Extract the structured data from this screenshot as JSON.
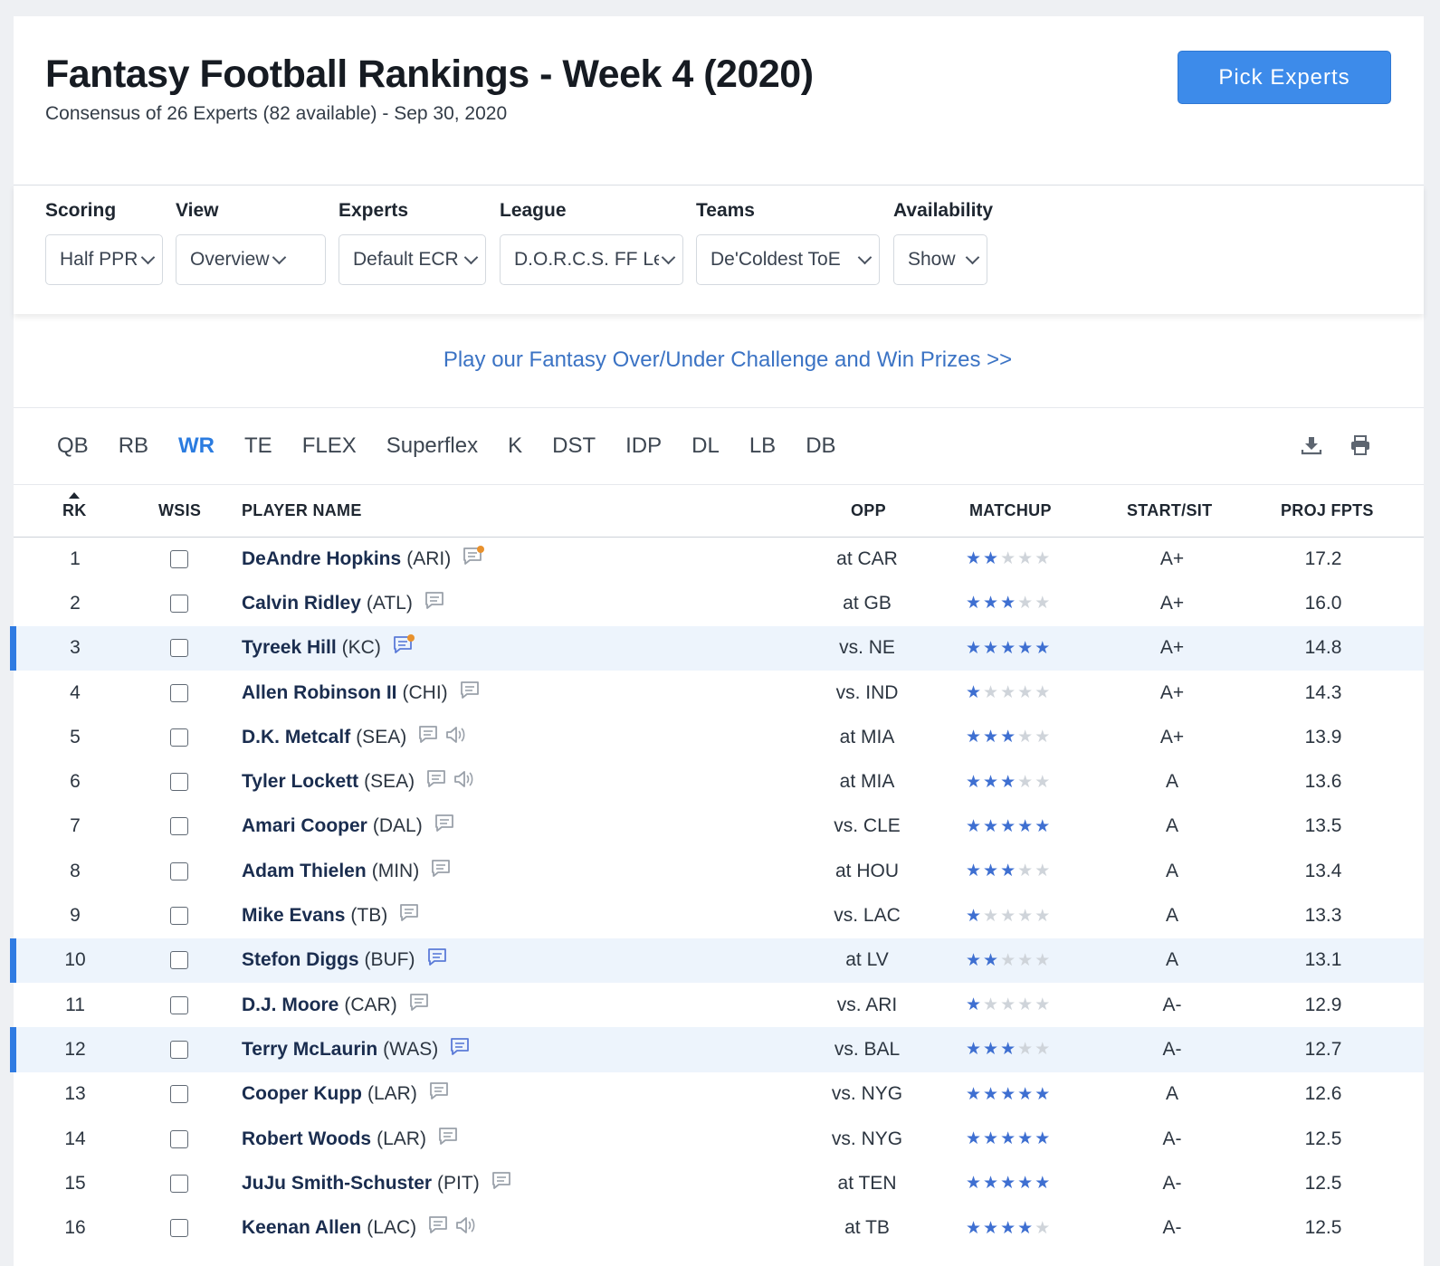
{
  "header": {
    "title": "Fantasy Football Rankings - Week 4 (2020)",
    "subtitle": "Consensus of 26 Experts (82 available) - Sep 30, 2020",
    "pick_experts_label": "Pick Experts"
  },
  "filters": {
    "scoring": {
      "label": "Scoring",
      "value": "Half PPR"
    },
    "view": {
      "label": "View",
      "value": "Overview"
    },
    "experts": {
      "label": "Experts",
      "value": "Default ECR"
    },
    "league": {
      "label": "League",
      "value": "D.O.R.C.S. FF League"
    },
    "teams": {
      "label": "Teams",
      "value": "De'Coldest ToE"
    },
    "availability": {
      "label": "Availability",
      "value": "Show"
    }
  },
  "promo": {
    "text": "Play our Fantasy Over/Under Challenge and Win Prizes >>"
  },
  "position_tabs": [
    "QB",
    "RB",
    "WR",
    "TE",
    "FLEX",
    "Superflex",
    "K",
    "DST",
    "IDP",
    "DL",
    "LB",
    "DB"
  ],
  "active_tab": "WR",
  "table": {
    "columns": {
      "rk": "RK",
      "wsis": "WSIS",
      "player": "PLAYER NAME",
      "opp": "OPP",
      "matchup": "MATCHUP",
      "start_sit": "START/SIT",
      "proj": "PROJ FPTS"
    },
    "rows": [
      {
        "rk": "1",
        "name": "DeAndre Hopkins",
        "team": "(ARI)",
        "opp": "at CAR",
        "stars": 2,
        "grade": "A+",
        "proj": "17.2",
        "note": "new",
        "audio": false,
        "highlight": false
      },
      {
        "rk": "2",
        "name": "Calvin Ridley",
        "team": "(ATL)",
        "opp": "at GB",
        "stars": 3,
        "grade": "A+",
        "proj": "16.0",
        "note": "gray",
        "audio": false,
        "highlight": false
      },
      {
        "rk": "3",
        "name": "Tyreek Hill",
        "team": "(KC)",
        "opp": "vs. NE",
        "stars": 5,
        "grade": "A+",
        "proj": "14.8",
        "note": "new-blue",
        "audio": false,
        "highlight": true
      },
      {
        "rk": "4",
        "name": "Allen Robinson II",
        "team": "(CHI)",
        "opp": "vs. IND",
        "stars": 1,
        "grade": "A+",
        "proj": "14.3",
        "note": "gray",
        "audio": false,
        "highlight": false
      },
      {
        "rk": "5",
        "name": "D.K. Metcalf",
        "team": "(SEA)",
        "opp": "at MIA",
        "stars": 3,
        "grade": "A+",
        "proj": "13.9",
        "note": "gray",
        "audio": true,
        "highlight": false
      },
      {
        "rk": "6",
        "name": "Tyler Lockett",
        "team": "(SEA)",
        "opp": "at MIA",
        "stars": 3,
        "grade": "A",
        "proj": "13.6",
        "note": "gray",
        "audio": true,
        "highlight": false
      },
      {
        "rk": "7",
        "name": "Amari Cooper",
        "team": "(DAL)",
        "opp": "vs. CLE",
        "stars": 5,
        "grade": "A",
        "proj": "13.5",
        "note": "gray",
        "audio": false,
        "highlight": false
      },
      {
        "rk": "8",
        "name": "Adam Thielen",
        "team": "(MIN)",
        "opp": "at HOU",
        "stars": 3,
        "grade": "A",
        "proj": "13.4",
        "note": "gray",
        "audio": false,
        "highlight": false
      },
      {
        "rk": "9",
        "name": "Mike Evans",
        "team": "(TB)",
        "opp": "vs. LAC",
        "stars": 1,
        "grade": "A",
        "proj": "13.3",
        "note": "gray",
        "audio": false,
        "highlight": false
      },
      {
        "rk": "10",
        "name": "Stefon Diggs",
        "team": "(BUF)",
        "opp": "at LV",
        "stars": 2,
        "grade": "A",
        "proj": "13.1",
        "note": "blue",
        "audio": false,
        "highlight": true
      },
      {
        "rk": "11",
        "name": "D.J. Moore",
        "team": "(CAR)",
        "opp": "vs. ARI",
        "stars": 1,
        "grade": "A-",
        "proj": "12.9",
        "note": "gray",
        "audio": false,
        "highlight": false
      },
      {
        "rk": "12",
        "name": "Terry McLaurin",
        "team": "(WAS)",
        "opp": "vs. BAL",
        "stars": 3,
        "grade": "A-",
        "proj": "12.7",
        "note": "blue",
        "audio": false,
        "highlight": true
      },
      {
        "rk": "13",
        "name": "Cooper Kupp",
        "team": "(LAR)",
        "opp": "vs. NYG",
        "stars": 5,
        "grade": "A",
        "proj": "12.6",
        "note": "gray",
        "audio": false,
        "highlight": false
      },
      {
        "rk": "14",
        "name": "Robert Woods",
        "team": "(LAR)",
        "opp": "vs. NYG",
        "stars": 5,
        "grade": "A-",
        "proj": "12.5",
        "note": "gray",
        "audio": false,
        "highlight": false
      },
      {
        "rk": "15",
        "name": "JuJu Smith-Schuster",
        "team": "(PIT)",
        "opp": "at TEN",
        "stars": 5,
        "grade": "A-",
        "proj": "12.5",
        "note": "gray",
        "audio": false,
        "highlight": false
      },
      {
        "rk": "16",
        "name": "Keenan Allen",
        "team": "(LAC)",
        "opp": "at TB",
        "stars": 4,
        "grade": "A-",
        "proj": "12.5",
        "note": "gray",
        "audio": true,
        "highlight": false
      }
    ]
  },
  "colors": {
    "accent": "#3d8bea",
    "link": "#3b73c4",
    "star_on": "#3e6fd1",
    "star_off": "#cfd4da",
    "highlight_bg": "#edf4fc",
    "highlight_bar": "#2f7be2"
  },
  "icons": {
    "download": "download-icon",
    "print": "print-icon",
    "note": "note-icon",
    "audio": "audio-icon",
    "sort": "sort-up-icon"
  }
}
